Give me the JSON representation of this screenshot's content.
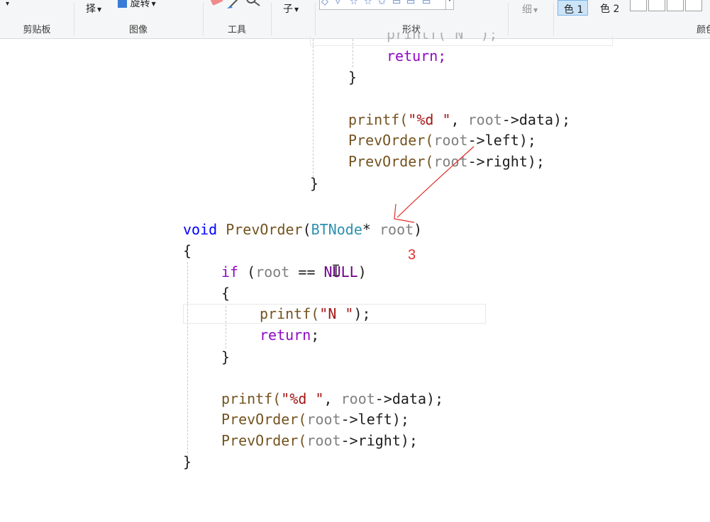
{
  "ribbon": {
    "select_label": "择",
    "rotate_label": "旋转",
    "fill_label": "子",
    "size_label": "细",
    "color1_label": "色 1",
    "color2_label": "色 2",
    "groups": {
      "clipboard": "剪贴板",
      "image": "图像",
      "tools": "工具",
      "shapes": "形状",
      "colors": "颜色"
    },
    "icons": [
      "dropdown-caret",
      "rotate-icon",
      "eraser-icon",
      "pencil-icon",
      "magnifier-icon",
      "shape-gallery"
    ]
  },
  "upper_code": {
    "line_partial": "printf(\"N \");",
    "line_return": "return;",
    "line_close_inner": "}",
    "line_printf": [
      "printf(",
      "\"%d \"",
      ", ",
      "root",
      "->data);"
    ],
    "line_left": [
      "PrevOrder(",
      "root",
      "->left);"
    ],
    "line_right": [
      "PrevOrder(",
      "root",
      "->right);"
    ],
    "line_close_outer": "}"
  },
  "lower_code": {
    "signature": [
      "void",
      " ",
      "PrevOrder",
      "(",
      "BTNode",
      "* ",
      "root",
      ")"
    ],
    "open_brace": "{",
    "if_line": [
      "if",
      " (",
      "root",
      " == ",
      "NULL",
      ")"
    ],
    "inner_open": "{",
    "printf_n": [
      "printf(",
      "\"N \"",
      ");"
    ],
    "return_line": [
      "return",
      ";"
    ],
    "inner_close": "}",
    "printf_data": [
      "printf(",
      "\"%d \"",
      ", ",
      "root",
      "->data);"
    ],
    "call_left": [
      "PrevOrder(",
      "root",
      "->left);"
    ],
    "call_right": [
      "PrevOrder(",
      "root",
      "->right);"
    ],
    "close_brace": "}"
  },
  "annotation": {
    "number": "3",
    "color": "#e0302a"
  },
  "colors": {
    "keyword": "#0000ff",
    "control": "#8f08c4",
    "function": "#74531f",
    "type": "#2b91af",
    "variable": "#808080",
    "string": "#a31515",
    "macro": "#6f008a"
  }
}
